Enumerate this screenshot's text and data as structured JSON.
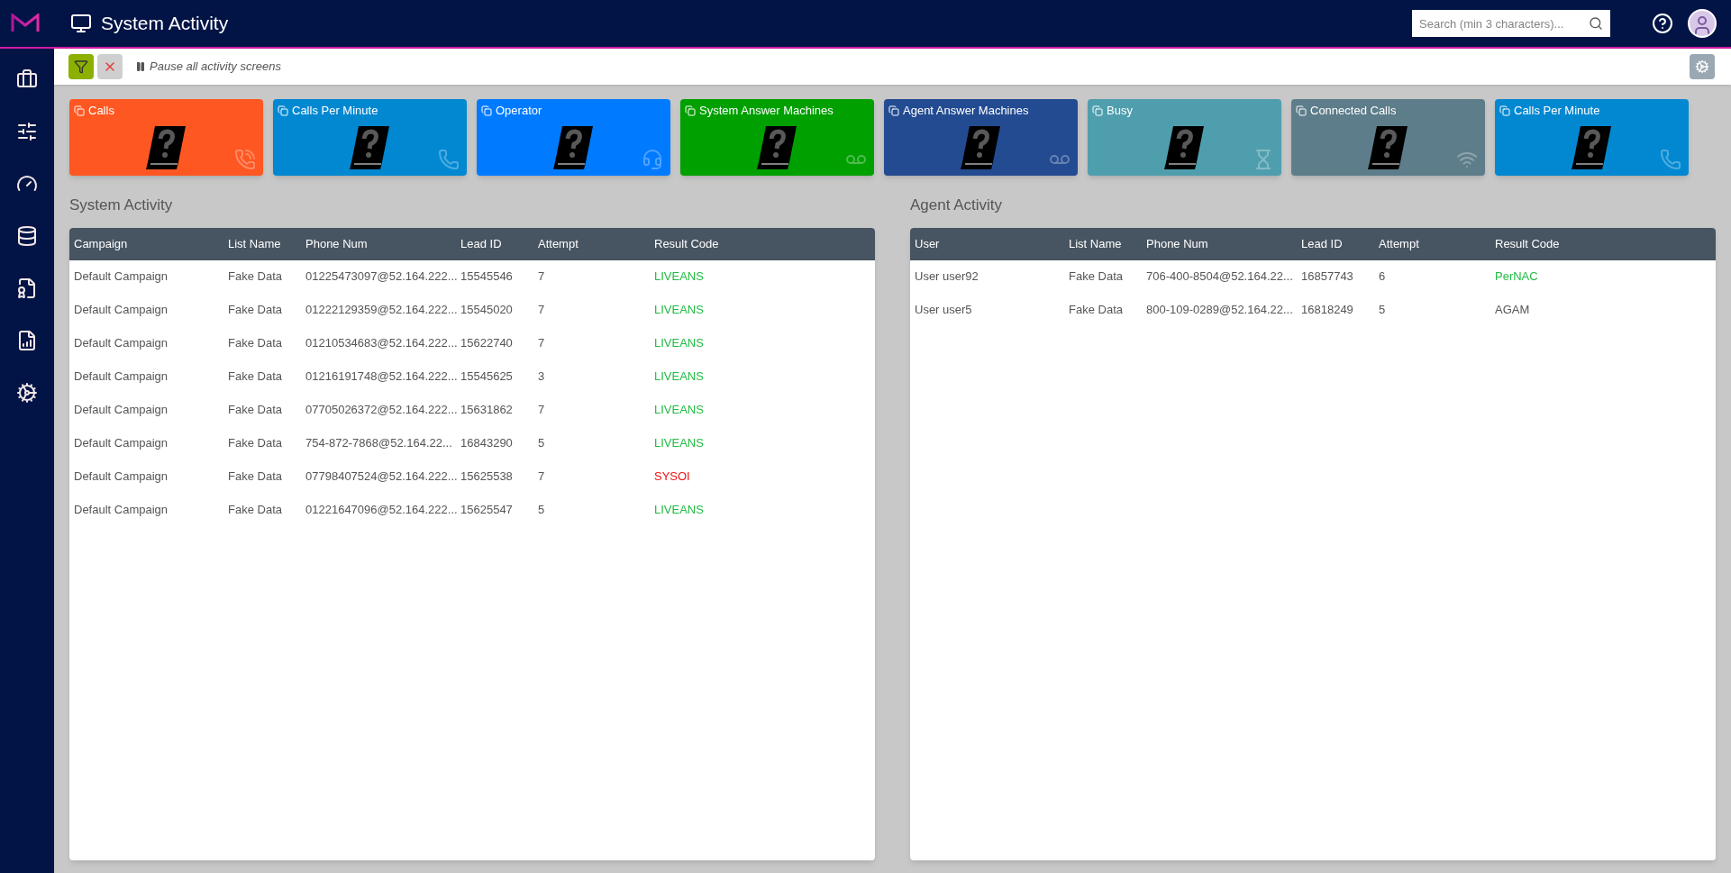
{
  "header": {
    "title": "System Activity",
    "search": {
      "placeholder": "Search (min 3 characters)..."
    }
  },
  "toolbar": {
    "pause_label": "Pause all activity screens"
  },
  "tiles": [
    {
      "label": "Calls",
      "color": "#ff5722",
      "kind": "ringing"
    },
    {
      "label": "Calls Per Minute",
      "color": "#0288d1",
      "kind": "phone"
    },
    {
      "label": "Operator",
      "color": "#007bff",
      "kind": "headset"
    },
    {
      "label": "System Answer Machines",
      "color": "#00a000",
      "kind": "voicemail"
    },
    {
      "label": "Agent Answer Machines",
      "color": "#234b91",
      "kind": "voicemail"
    },
    {
      "label": "Busy",
      "color": "#4f9eae",
      "kind": "hourglass"
    },
    {
      "label": "Connected Calls",
      "color": "#5d7d8a",
      "kind": "wifi"
    },
    {
      "label": "Calls Per Minute",
      "color": "#0288d1",
      "kind": "phone"
    }
  ],
  "system_activity": {
    "title": "System Activity",
    "columns": [
      "Campaign",
      "List Name",
      "Phone Num",
      "Lead ID",
      "Attempt",
      "Result Code"
    ],
    "rows": [
      {
        "cells": [
          "Default Campaign",
          "Fake Data",
          "01225473097@52.164.222...",
          "15545546",
          "7",
          "LIVEANS"
        ],
        "color": "#22bb44"
      },
      {
        "cells": [
          "Default Campaign",
          "Fake Data",
          "01222129359@52.164.222...",
          "15545020",
          "7",
          "LIVEANS"
        ],
        "color": "#22bb44"
      },
      {
        "cells": [
          "Default Campaign",
          "Fake Data",
          "01210534683@52.164.222...",
          "15622740",
          "7",
          "LIVEANS"
        ],
        "color": "#22bb44"
      },
      {
        "cells": [
          "Default Campaign",
          "Fake Data",
          "01216191748@52.164.222...",
          "15545625",
          "3",
          "LIVEANS"
        ],
        "color": "#22bb44"
      },
      {
        "cells": [
          "Default Campaign",
          "Fake Data",
          "07705026372@52.164.222...",
          "15631862",
          "7",
          "LIVEANS"
        ],
        "color": "#22bb44"
      },
      {
        "cells": [
          "Default Campaign",
          "Fake Data",
          "754-872-7868@52.164.22...",
          "16843290",
          "5",
          "LIVEANS"
        ],
        "color": "#22bb44"
      },
      {
        "cells": [
          "Default Campaign",
          "Fake Data",
          "07798407524@52.164.222...",
          "15625538",
          "7",
          "SYSOI"
        ],
        "color": "#ee1111"
      },
      {
        "cells": [
          "Default Campaign",
          "Fake Data",
          "01221647096@52.164.222...",
          "15625547",
          "5",
          "LIVEANS"
        ],
        "color": "#22bb44"
      }
    ]
  },
  "agent_activity": {
    "title": "Agent Activity",
    "columns": [
      "User",
      "List Name",
      "Phone Num",
      "Lead ID",
      "Attempt",
      "Result Code"
    ],
    "rows": [
      {
        "cells": [
          "User user92",
          "Fake Data",
          "706-400-8504@52.164.22...",
          "16857743",
          "6",
          "PerNAC"
        ],
        "color": "#22bb44"
      },
      {
        "cells": [
          "User user5",
          "Fake Data",
          "800-109-0289@52.164.22...",
          "16818249",
          "5",
          "AGAM"
        ],
        "color": "#555555"
      }
    ]
  }
}
